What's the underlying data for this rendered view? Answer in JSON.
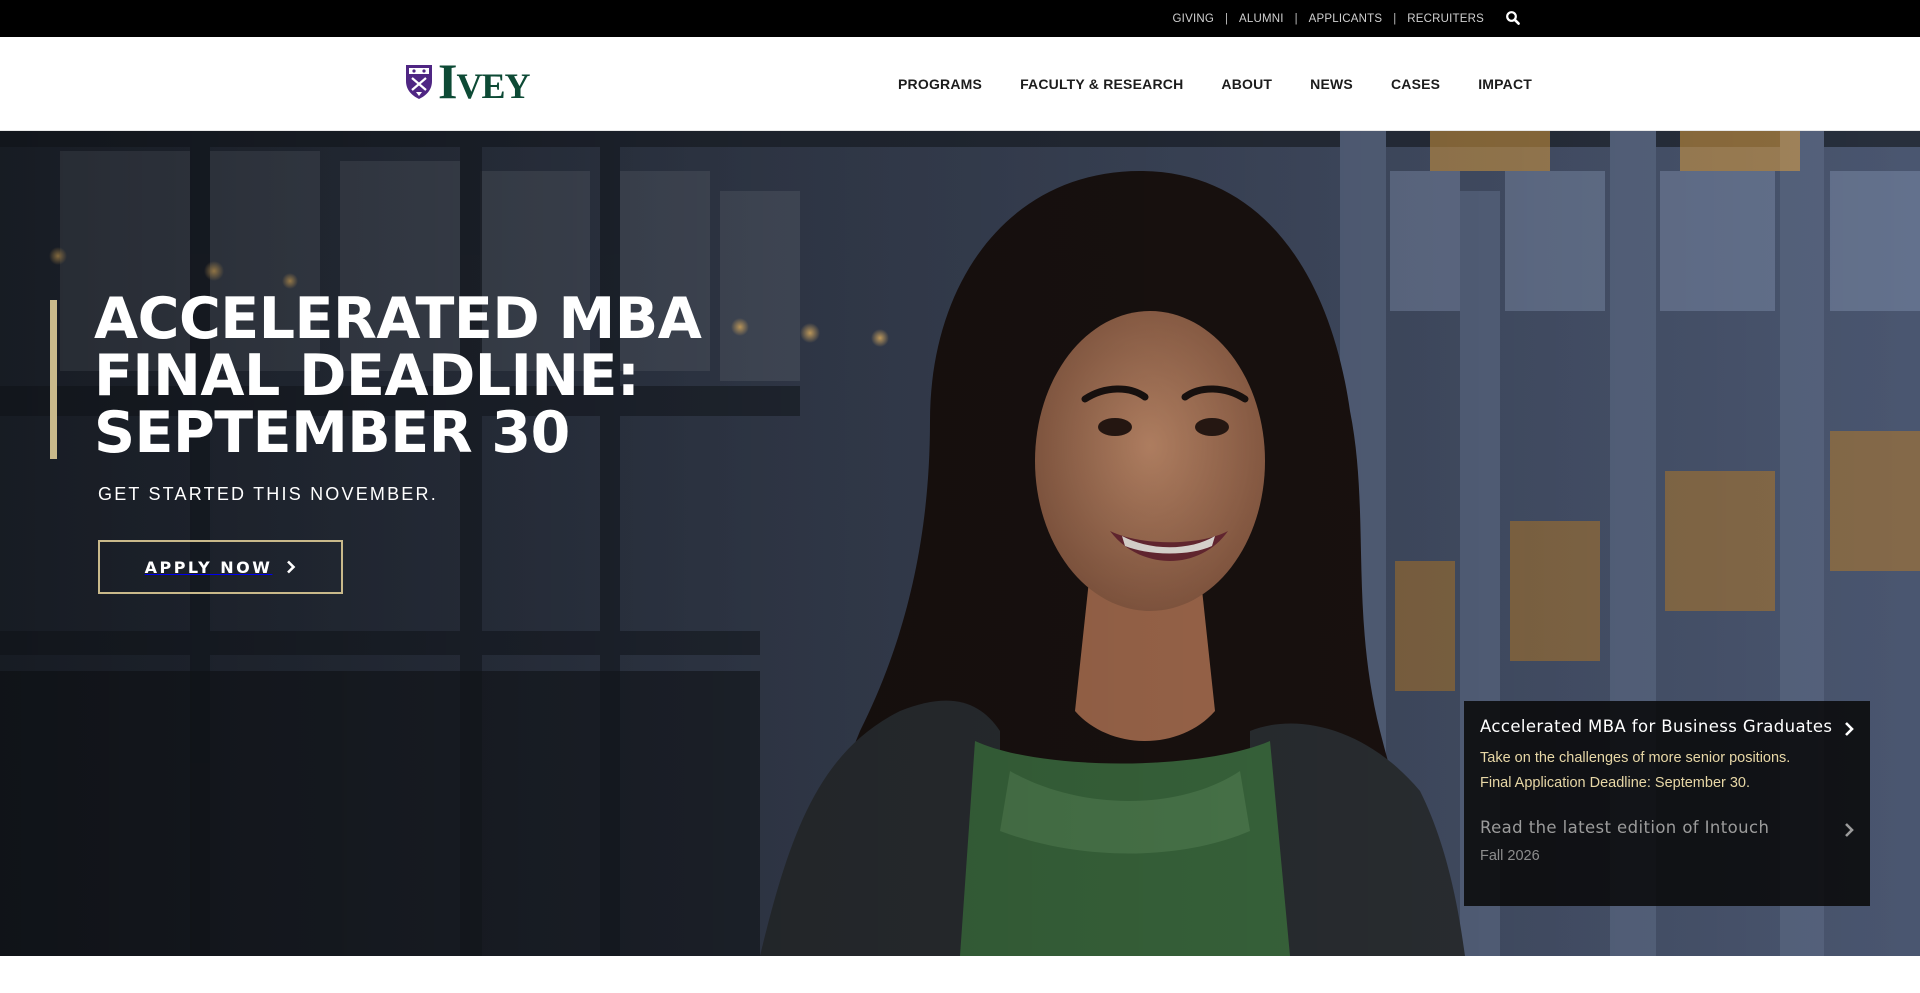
{
  "utility_bar": {
    "links": [
      "GIVING",
      "ALUMNI",
      "APPLICANTS",
      "RECRUITERS"
    ],
    "separator": "|",
    "search_icon": "search-icon"
  },
  "header": {
    "logo_text": "IVEY",
    "logo_icon": "crest-icon",
    "nav": [
      "PROGRAMS",
      "FACULTY & RESEARCH",
      "ABOUT",
      "NEWS",
      "CASES",
      "IMPACT"
    ]
  },
  "hero": {
    "headline": [
      "ACCELERATED MBA",
      "FINAL DEADLINE:",
      "SEPTEMBER 30"
    ],
    "subhead": "GET STARTED THIS NOVEMBER.",
    "cta_label": "APPLY NOW",
    "cta_icon": "chevron-right-icon"
  },
  "side_panel": {
    "items": [
      {
        "title": "Accelerated MBA for Business Graduates",
        "desc_line1": "Take on the challenges of more senior positions.",
        "desc_line2": "Final Application Deadline: September 30."
      },
      {
        "title": "Read the latest edition of Intouch",
        "desc_line1": "Fall 2026"
      }
    ]
  },
  "colors": {
    "utility_bg": "#000000",
    "brand_green": "#0d4a35",
    "brand_purple": "#4f2683",
    "accent_gold": "#c9b98a",
    "panel_gold_text": "#e7d7a6"
  }
}
